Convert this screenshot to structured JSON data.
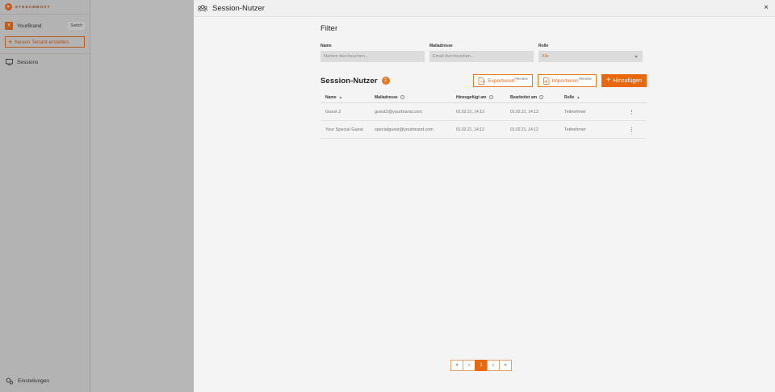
{
  "sidebar": {
    "logo_text": "STREAMBOXY",
    "tenant_initial": "Y",
    "tenant_name": "YourBrand",
    "switch_label": "Switch",
    "new_tenant_label": "Neuen Tenant erstellen",
    "nav_sessions": "Sessions",
    "settings_label": "Einstellungen"
  },
  "panel": {
    "title": "Session-Nutzer",
    "close": "×"
  },
  "filter": {
    "title": "Filter",
    "name_label": "Name",
    "name_placeholder": "Namen durchsuchen...",
    "mail_label": "Mailadresse",
    "mail_placeholder": "Email durchsuchen...",
    "role_label": "Rolle",
    "role_value": "Alle"
  },
  "section": {
    "title": "Session-Nutzer",
    "count": "2",
    "export_label": "Exportieren",
    "export_tag": "PREVIEW",
    "import_label": "Importieren",
    "import_tag": "PREVIEW",
    "add_label": "Hinzufügen"
  },
  "table": {
    "headers": {
      "name": "Name",
      "mail": "Mailadresse",
      "added": "Hinzugefügt am",
      "edited": "Bearbeitet am",
      "role": "Rolle"
    },
    "rows": [
      {
        "name": "Guest 2",
        "mail": "guest2@yourbrand.com",
        "added": "01.02.21, 14:13",
        "edited": "01.02.21, 14:13",
        "role": "Teilnehmer",
        "menu": "⋮"
      },
      {
        "name": "Your Special Guest",
        "mail": "specialguest@yourbrand.com",
        "added": "01.02.21, 14:12",
        "edited": "01.02.21, 14:12",
        "role": "Teilnehmer",
        "menu": "⋮"
      }
    ]
  },
  "pagination": {
    "first": "«",
    "prev": "‹",
    "current": "1",
    "next": "›",
    "last": "»"
  },
  "colors": {
    "accent": "#e8680f",
    "overlay": "#a9a9a9",
    "panel_bg": "#f4f4f4"
  },
  "icons": [
    "users-icon",
    "close-icon",
    "upload-icon",
    "download-icon",
    "plus-icon",
    "sort-asc-icon",
    "info-icon",
    "more-vertical-icon",
    "sessions-icon",
    "settings-icon"
  ]
}
